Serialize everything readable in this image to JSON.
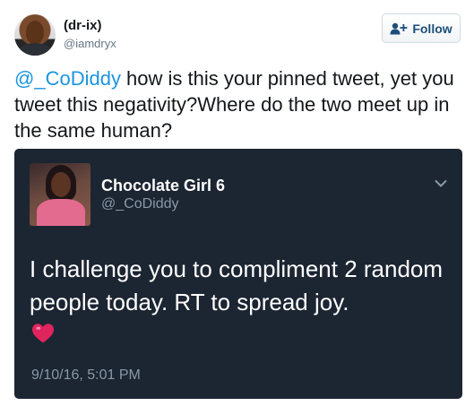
{
  "author": {
    "display_name": "(dr-ix)",
    "handle": "@iamdryx"
  },
  "follow_button": {
    "label": "Follow",
    "icon": "add-user-icon"
  },
  "tweet": {
    "mention": "@_CoDiddy",
    "text": " how is this your pinned tweet, yet you tweet this negativity?Where do the two meet up in the same human?"
  },
  "quoted_tweet": {
    "display_name": "Chocolate Girl 6",
    "handle": "@_CoDiddy",
    "text": "I challenge you to compliment 2 random people today. RT to spread joy.",
    "emoji": "heart-icon",
    "timestamp": "9/10/16, 5:01 PM",
    "menu_icon": "chevron-down-icon"
  },
  "colors": {
    "link": "#1b95e0",
    "card_background": "#1c2532",
    "heart": "#e0245e"
  }
}
